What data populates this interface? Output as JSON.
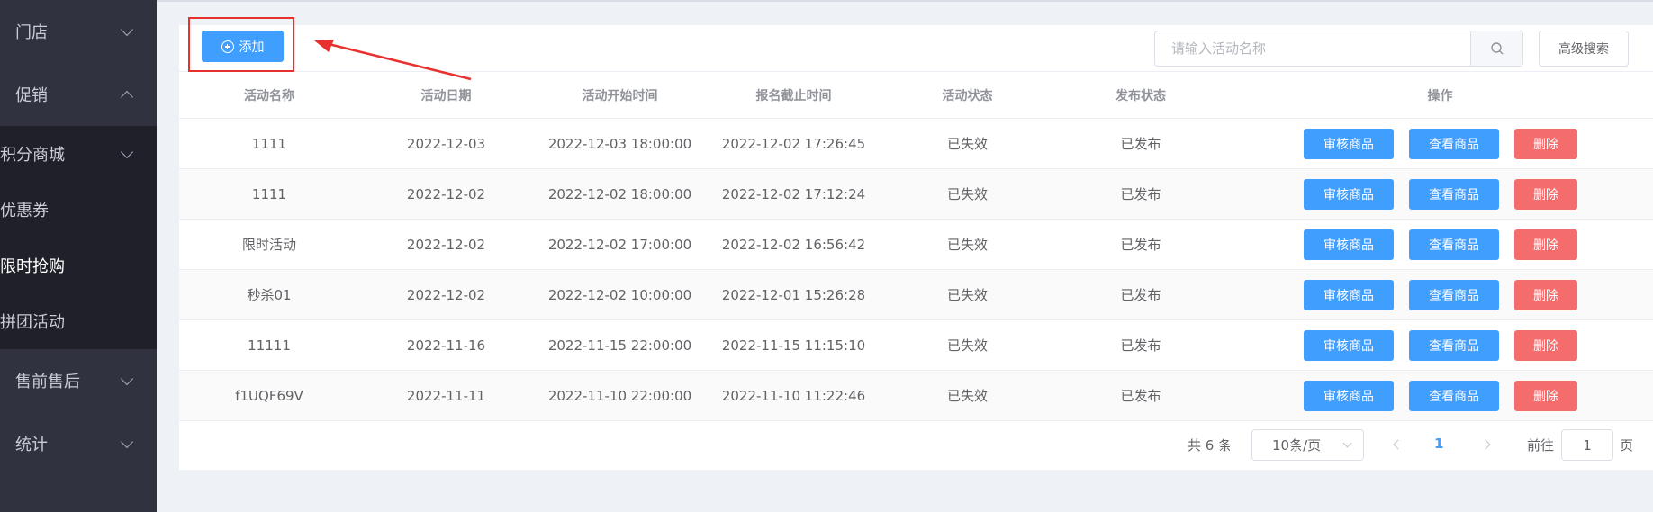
{
  "sidebar": {
    "groups": [
      {
        "label": "门店",
        "expanded": false
      },
      {
        "label": "促销",
        "expanded": true
      }
    ],
    "sub_items": [
      {
        "label": "积分商城",
        "has_chevron": true
      },
      {
        "label": "优惠券",
        "has_chevron": false
      },
      {
        "label": "限时抢购",
        "has_chevron": false,
        "active": true
      },
      {
        "label": "拼团活动",
        "has_chevron": false
      }
    ],
    "groups_after": [
      {
        "label": "售前售后"
      },
      {
        "label": "统计"
      }
    ]
  },
  "toolbar": {
    "add_label": "添加",
    "search_placeholder": "请输入活动名称",
    "advanced_search_label": "高级搜索"
  },
  "table": {
    "columns": [
      "活动名称",
      "活动日期",
      "活动开始时间",
      "报名截止时间",
      "活动状态",
      "发布状态",
      "操作"
    ],
    "rows": [
      {
        "name": "1111",
        "date": "2022-12-03",
        "start": "2022-12-03 18:00:00",
        "deadline": "2022-12-02 17:26:45",
        "status": "已失效",
        "publish": "已发布"
      },
      {
        "name": "1111",
        "date": "2022-12-02",
        "start": "2022-12-02 18:00:00",
        "deadline": "2022-12-02 17:12:24",
        "status": "已失效",
        "publish": "已发布"
      },
      {
        "name": "限时活动",
        "date": "2022-12-02",
        "start": "2022-12-02 17:00:00",
        "deadline": "2022-12-02 16:56:42",
        "status": "已失效",
        "publish": "已发布"
      },
      {
        "name": "秒杀01",
        "date": "2022-12-02",
        "start": "2022-12-02 10:00:00",
        "deadline": "2022-12-01 15:26:28",
        "status": "已失效",
        "publish": "已发布"
      },
      {
        "name": "11111",
        "date": "2022-11-16",
        "start": "2022-11-15 22:00:00",
        "deadline": "2022-11-15 11:15:10",
        "status": "已失效",
        "publish": "已发布"
      },
      {
        "name": "f1UQF69V",
        "date": "2022-11-11",
        "start": "2022-11-10 22:00:00",
        "deadline": "2022-11-10 11:22:46",
        "status": "已失效",
        "publish": "已发布"
      }
    ],
    "actions": {
      "review": "审核商品",
      "view": "查看商品",
      "delete": "删除"
    }
  },
  "pagination": {
    "total_text": "共 6 条",
    "page_size": "10条/页",
    "current_page": "1",
    "goto_label": "前往",
    "goto_value": "1",
    "goto_suffix": "页"
  },
  "colors": {
    "primary": "#409eff",
    "danger": "#f56c6c",
    "sidebar_bg": "#30323f",
    "submenu_bg": "#1f2029",
    "annotation_red": "#e8312f"
  }
}
